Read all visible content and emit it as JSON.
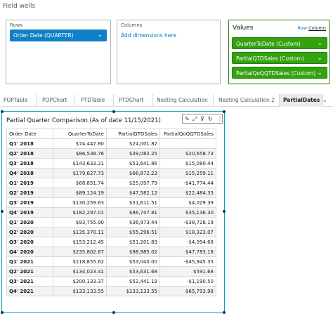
{
  "field_wells": {
    "title": "Field wells",
    "rows": {
      "label": "Rows",
      "pill": "Order Date (QUARTER)"
    },
    "columns": {
      "label": "Columns",
      "add_label": "Add dimensions here"
    },
    "values": {
      "label": "Values",
      "toggle_row": "Row",
      "toggle_column": "Column",
      "pills": [
        "QuarterToDate (Custom)",
        "PartialQTDSales (Custom)",
        "PartialQoQQTDSales (Custom)"
      ]
    }
  },
  "tabs": [
    {
      "label": "POPTable"
    },
    {
      "label": "POPChart"
    },
    {
      "label": "PTDTable"
    },
    {
      "label": "PTDChart"
    },
    {
      "label": "Nesting Calculation"
    },
    {
      "label": "Nesting Calculation 2"
    },
    {
      "label": "PartialDates",
      "active": true
    }
  ],
  "visual": {
    "title": "Partial Quarter Comparison (As of date 11/15/2021)",
    "toolbar_icons": [
      "pencil-icon",
      "expand-icon",
      "filter-icon",
      "refresh-icon",
      "more-icon"
    ],
    "table": {
      "headers": [
        "Order Date",
        "QuarterToDate",
        "PartialQTDSales",
        "PartialQoQQTDSales"
      ],
      "rows": [
        [
          "Q1' 2018",
          "$74,447.80",
          "$24,001.82",
          ""
        ],
        [
          "Q2' 2018",
          "$86,538.76",
          "$39,082.25",
          "$20,658.73"
        ],
        [
          "Q3' 2018",
          "$143,633.21",
          "$51,641.86",
          "$15,080.44"
        ],
        [
          "Q4' 2018",
          "$179,627.73",
          "$66,872.23",
          "$15,259.11"
        ],
        [
          "Q1' 2019",
          "$68,851.74",
          "$25,097.79",
          "-$41,774.44"
        ],
        [
          "Q2' 2019",
          "$89,124.19",
          "$47,582.12",
          "$22,484.33"
        ],
        [
          "Q3' 2019",
          "$130,259.63",
          "$51,611.51",
          "$4,029.39"
        ],
        [
          "Q4' 2019",
          "$182,297.01",
          "$86,747.81",
          "$35,136.30"
        ],
        [
          "Q1' 2020",
          "$93,755.90",
          "$36,973.44",
          "-$38,728.19"
        ],
        [
          "Q2' 2020",
          "$135,370.11",
          "$55,296.51",
          "$18,323.07"
        ],
        [
          "Q3' 2020",
          "$153,212.45",
          "$51,201.83",
          "-$4,094.68"
        ],
        [
          "Q4' 2020",
          "$235,802.87",
          "$98,985.02",
          "$47,783.18"
        ],
        [
          "Q1' 2021",
          "$118,855.62",
          "$53,040.00",
          "-$45,945.35"
        ],
        [
          "Q2' 2021",
          "$134,023.41",
          "$53,631.68",
          "$591.68"
        ],
        [
          "Q3' 2021",
          "$200,133.37",
          "$52,441.19",
          "-$1,190.50"
        ],
        [
          "Q4' 2021",
          "$133,133.55",
          "$133,133.55",
          "$65,793.98"
        ]
      ]
    }
  }
}
